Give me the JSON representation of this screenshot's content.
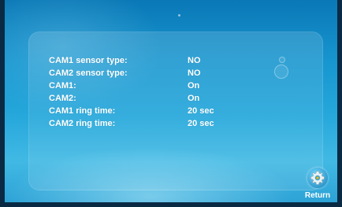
{
  "settings": {
    "rows": [
      {
        "label": "CAM1 sensor type:",
        "value": "NO"
      },
      {
        "label": "CAM2 sensor type:",
        "value": "NO"
      },
      {
        "label": "CAM1:",
        "value": "On"
      },
      {
        "label": "CAM2:",
        "value": "On"
      },
      {
        "label": "CAM1 ring time:",
        "value": "20 sec"
      },
      {
        "label": "CAM2 ring time:",
        "value": "20 sec"
      }
    ]
  },
  "return_button": {
    "label": "Return",
    "icon": "gear-icon"
  }
}
